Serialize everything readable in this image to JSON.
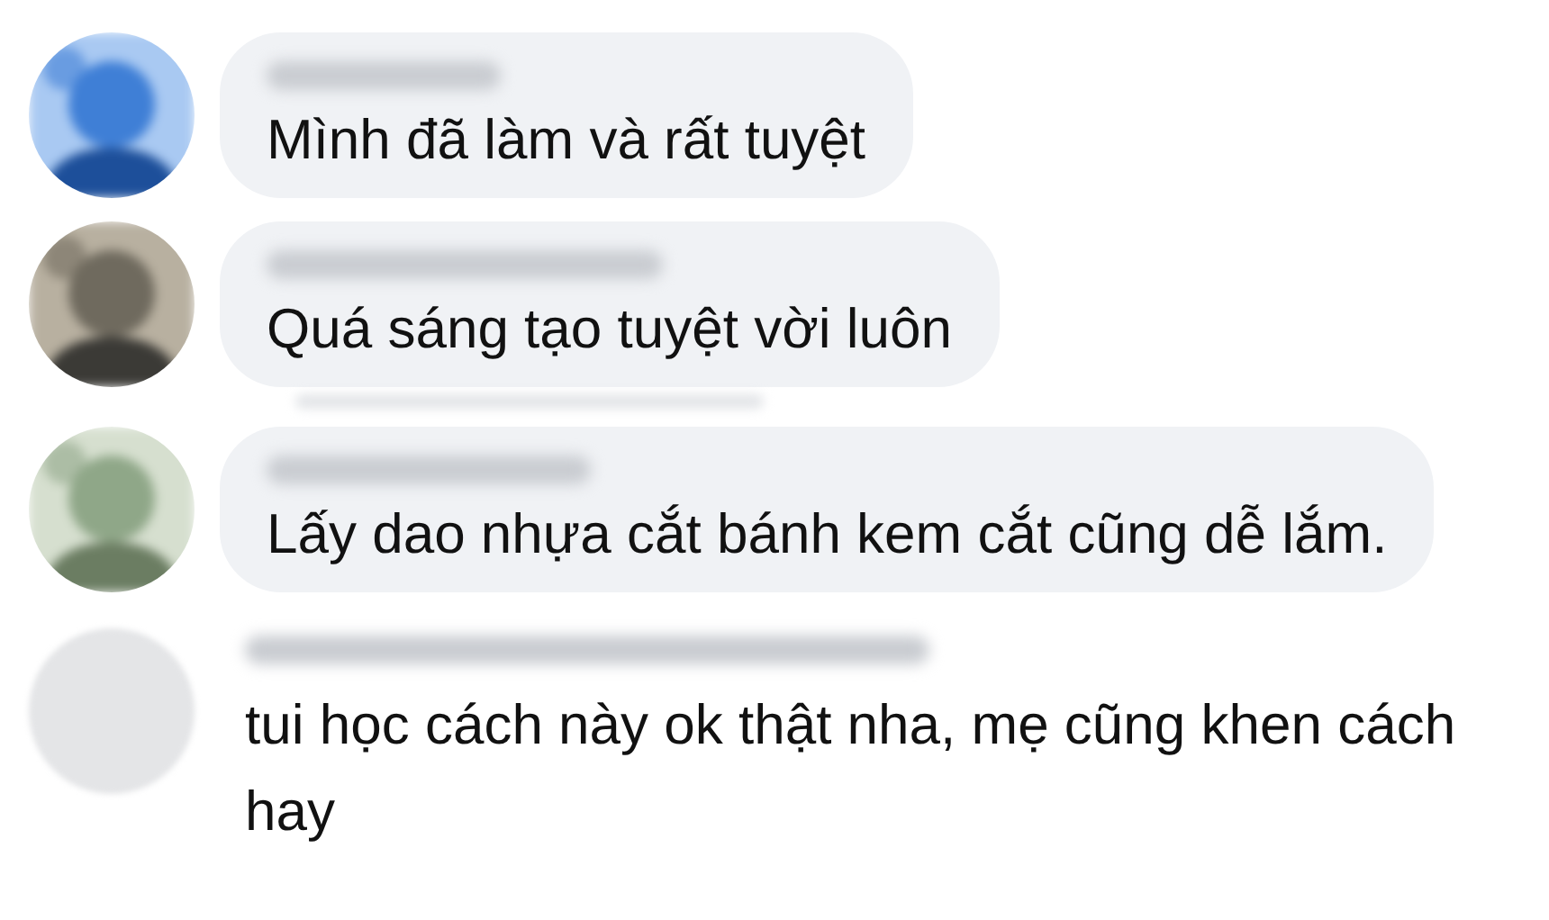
{
  "comments": [
    {
      "kind": "bubble",
      "text": "Mình đã làm và rất tuyệt"
    },
    {
      "kind": "bubble",
      "text": "Quá sáng tạo tuyệt vời luôn"
    },
    {
      "kind": "bubble",
      "text": "Lấy dao nhựa cắt bánh kem cắt cũng dễ lắm."
    },
    {
      "kind": "plain",
      "text": "tui học cách này ok thật nha, mẹ cũng khen cách hay"
    }
  ]
}
